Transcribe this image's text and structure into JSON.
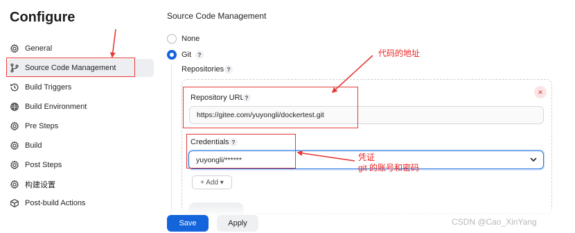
{
  "page_title": "Configure",
  "sidebar": {
    "items": [
      {
        "label": "General",
        "icon": "gear-icon"
      },
      {
        "label": "Source Code Management",
        "icon": "branch-icon",
        "active": true
      },
      {
        "label": "Build Triggers",
        "icon": "clock-icon"
      },
      {
        "label": "Build Environment",
        "icon": "globe-icon"
      },
      {
        "label": "Pre Steps",
        "icon": "gear-icon"
      },
      {
        "label": "Build",
        "icon": "gear-icon"
      },
      {
        "label": "Post Steps",
        "icon": "gear-icon"
      },
      {
        "label": "构建设置",
        "icon": "gear-icon"
      },
      {
        "label": "Post-build Actions",
        "icon": "box-icon"
      }
    ]
  },
  "scm": {
    "title": "Source Code Management",
    "none_label": "None",
    "git_label": "Git",
    "repositories_label": "Repositories",
    "help_glyph": "?",
    "repo_url_label": "Repository URL",
    "repo_url_value": "https://gitee.com/yuyongli/dockertest.git",
    "credentials_label": "Credentials",
    "credentials_value": "yuyongli/******",
    "add_label": "+ Add ▾",
    "close_glyph": "×"
  },
  "footer": {
    "save_label": "Save",
    "apply_label": "Apply"
  },
  "annotations": {
    "repo_url_note": "代码的地址",
    "credentials_note_line1": "凭证",
    "credentials_note_line2": "git 的账号和密码"
  },
  "watermark": "CSDN @Cao_XinYang",
  "colors": {
    "accent": "#1464dc",
    "annotation": "#e53935",
    "active_bg": "#eceef2"
  }
}
